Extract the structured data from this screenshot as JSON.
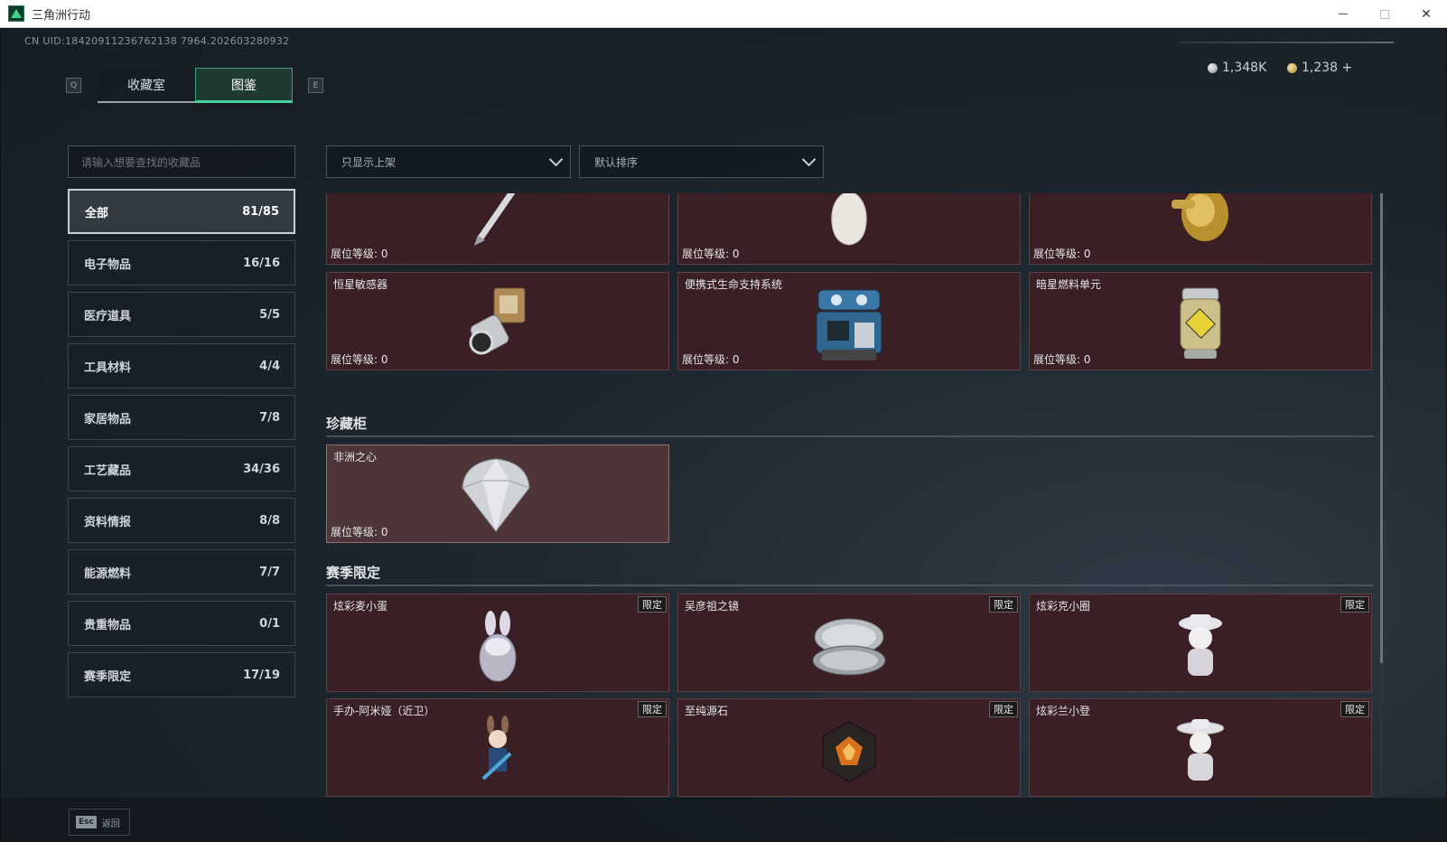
{
  "window": {
    "title": "三角洲行动"
  },
  "header": {
    "uid": "CN UID:18420911236762138 7964.202603280932",
    "tab_prev_key": "Q",
    "tab_next_key": "E",
    "tabs": [
      {
        "label": "收藏室"
      },
      {
        "label": "图鉴"
      }
    ],
    "currency": [
      {
        "icon": "silver-coin-icon",
        "value": "1,348K"
      },
      {
        "icon": "gold-coin-icon",
        "value": "1,238 +"
      }
    ]
  },
  "sidebar": {
    "search_placeholder": "请输入想要查找的收藏品",
    "categories": [
      {
        "label": "全部",
        "count": "81/85"
      },
      {
        "label": "电子物品",
        "count": "16/16"
      },
      {
        "label": "医疗道具",
        "count": "5/5"
      },
      {
        "label": "工具材料",
        "count": "4/4"
      },
      {
        "label": "家居物品",
        "count": "7/8"
      },
      {
        "label": "工艺藏品",
        "count": "34/36"
      },
      {
        "label": "资料情报",
        "count": "8/8"
      },
      {
        "label": "能源燃料",
        "count": "7/7"
      },
      {
        "label": "贵重物品",
        "count": "0/1"
      },
      {
        "label": "赛季限定",
        "count": "17/19"
      }
    ]
  },
  "filters": {
    "shelf_filter": "只显示上架",
    "sort": "默认排序"
  },
  "level_label": "展位等级: 0",
  "limited_label": "限定",
  "grid": {
    "top_row": [
      {
        "name": "",
        "icon": "pen-icon"
      },
      {
        "name": "",
        "icon": "vase-icon"
      },
      {
        "name": "",
        "icon": "gold-statue-icon"
      }
    ],
    "row2": [
      {
        "name": "恒星敏感器",
        "icon": "sensor-icon"
      },
      {
        "name": "便携式生命支持系统",
        "icon": "life-support-icon"
      },
      {
        "name": "暗星燃料单元",
        "icon": "fuel-cell-icon"
      }
    ]
  },
  "sections": {
    "treasure_cabinet": {
      "title": "珍藏柜",
      "items": [
        {
          "name": "非洲之心",
          "icon": "diamond-icon"
        }
      ]
    },
    "season_limited": {
      "title": "赛季限定",
      "items": [
        {
          "name": "炫彩麦小蛋",
          "icon": "bunny-egg-icon"
        },
        {
          "name": "吴彦祖之镜",
          "icon": "compact-mirror-icon"
        },
        {
          "name": "炫彩克小圈",
          "icon": "figure-hat-icon"
        },
        {
          "name": "手办-阿米娅（近卫）",
          "icon": "figurine-icon"
        },
        {
          "name": "至纯源石",
          "icon": "source-stone-icon"
        },
        {
          "name": "炫彩兰小登",
          "icon": "figure-sombrero-icon"
        }
      ]
    }
  },
  "footer": {
    "esc_key": "Esc",
    "back_label": "返回"
  },
  "colors": {
    "accent": "#44d399",
    "card_bg": "#3a1f24",
    "highlight_card": "#4d3538"
  }
}
